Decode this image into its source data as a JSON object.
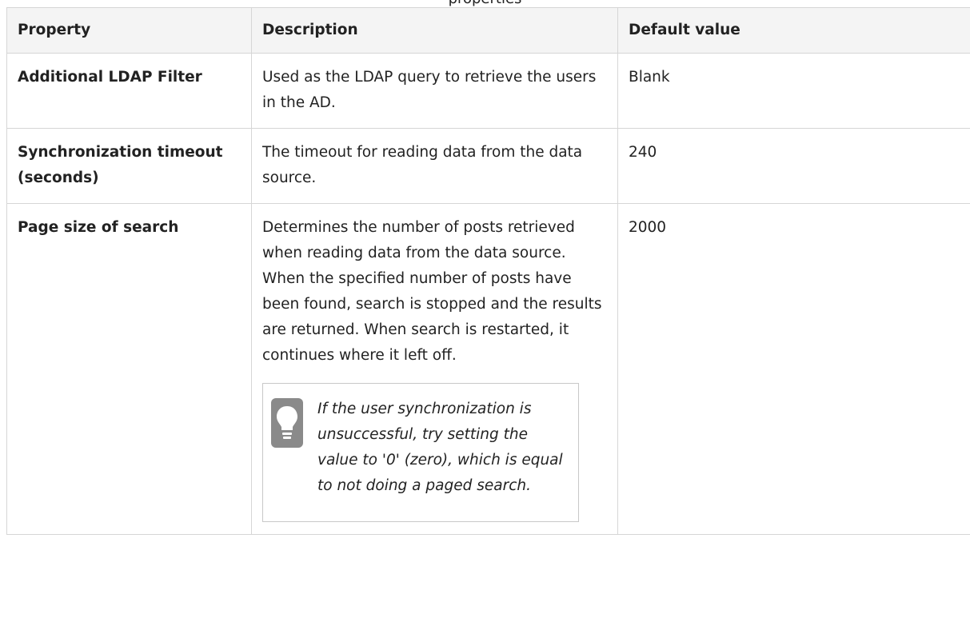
{
  "caption_fragment": "properties",
  "table": {
    "headers": [
      "Property",
      "Description",
      "Default value"
    ],
    "rows": [
      {
        "property": "Additional LDAP Filter",
        "description": "Used as the LDAP query to retrieve the users in the AD.",
        "default": "Blank"
      },
      {
        "property": "Synchronization timeout (seconds)",
        "description": "The timeout for reading data from the data source.",
        "default": "240"
      },
      {
        "property": "Page size of search",
        "description": "Determines the number of posts retrieved when reading data from the data source. When the specified number of posts have been found, search is stopped and the results are returned. When search is restarted, it continues where it left off.",
        "default": "2000",
        "tip": {
          "icon": "lightbulb-icon",
          "text": "If the user synchronization is unsuccessful, try setting the value to '0' (zero), which is equal to not doing a paged search."
        }
      }
    ]
  },
  "colors": {
    "header_bg": "#f4f4f4",
    "border": "#d6d6d6",
    "tip_border": "#c8c8c8",
    "icon_gray": "#8a8a8a"
  }
}
